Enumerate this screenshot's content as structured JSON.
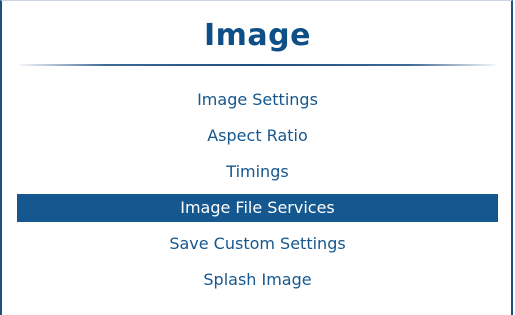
{
  "page_title": "Image",
  "menu": {
    "items": [
      {
        "label": "Image Settings",
        "selected": false
      },
      {
        "label": "Aspect Ratio",
        "selected": false
      },
      {
        "label": "Timings",
        "selected": false
      },
      {
        "label": "Image File Services",
        "selected": true
      },
      {
        "label": "Save Custom Settings",
        "selected": false
      },
      {
        "label": "Splash Image",
        "selected": false
      }
    ]
  },
  "colors": {
    "accent": "#14588f",
    "text": "#15578f",
    "selected_text": "#ffffff",
    "frame": "#1f4f82"
  }
}
